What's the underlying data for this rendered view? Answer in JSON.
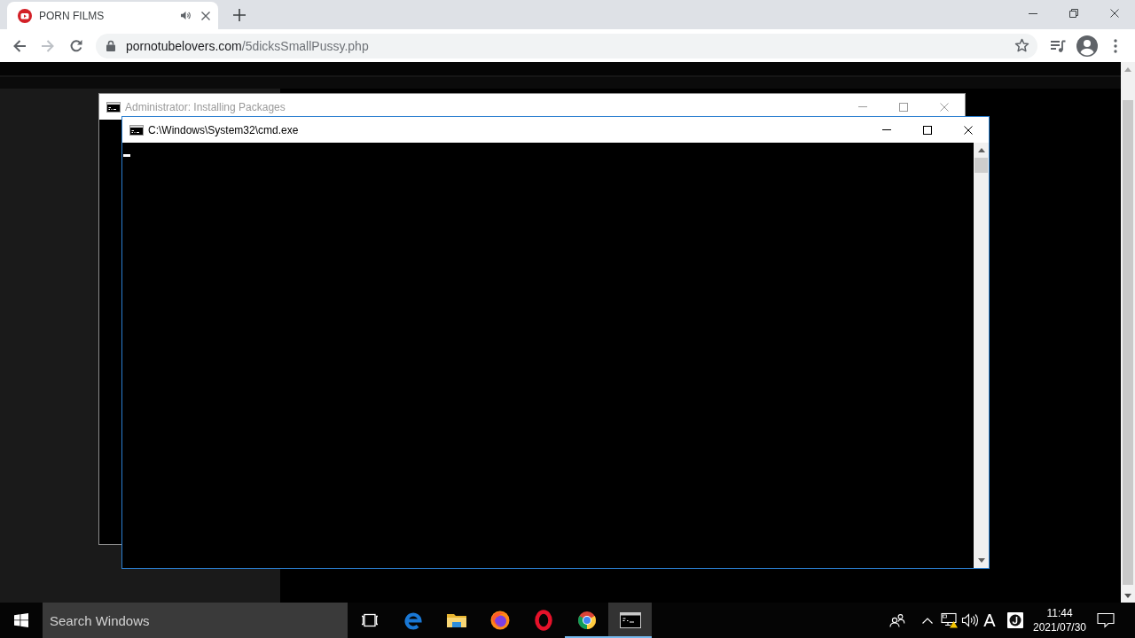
{
  "browser": {
    "tabs": [
      {
        "title": "PORN FILMS",
        "selected": true,
        "audio": true
      }
    ],
    "address_bar": {
      "host": "pornotubelovers.com",
      "path": "/5dicksSmallPussy.php"
    }
  },
  "windows": [
    {
      "title": "Administrator: Installing Packages",
      "active": false,
      "cursor": false
    },
    {
      "title": "C:\\Windows\\System32\\cmd.exe",
      "active": true,
      "cursor": true
    }
  ],
  "taskbar": {
    "search": {
      "placeholder": "Search Windows"
    },
    "apps": [
      {
        "kind": "edge",
        "running": false,
        "selected": false
      },
      {
        "kind": "explorer",
        "running": false,
        "selected": false
      },
      {
        "kind": "firefox",
        "running": false,
        "selected": false
      },
      {
        "kind": "opera",
        "running": false,
        "selected": false
      },
      {
        "kind": "chrome",
        "running": true,
        "selected": false
      },
      {
        "kind": "cmd",
        "running": true,
        "selected": true
      }
    ],
    "input_indicator": "A",
    "clock": {
      "time": "11:44",
      "date": "2021/07/30"
    }
  }
}
